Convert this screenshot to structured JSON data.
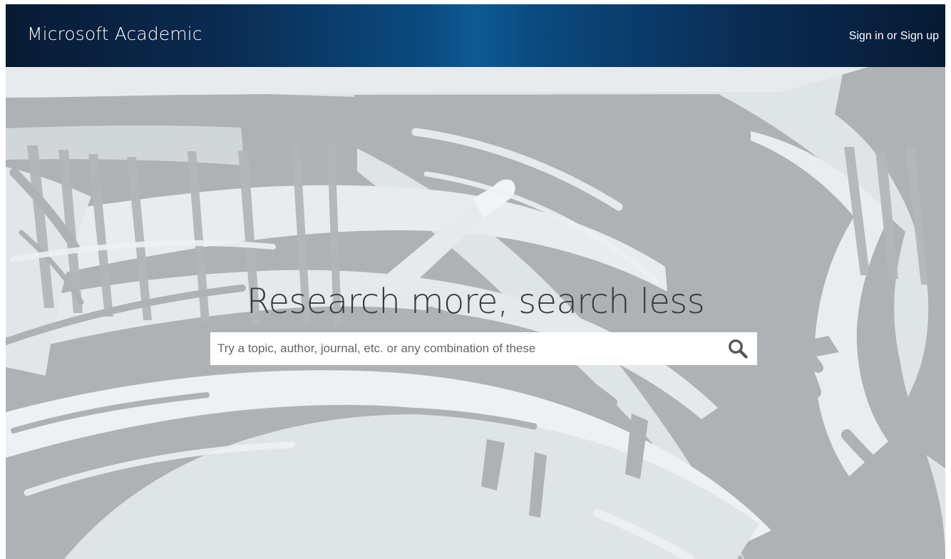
{
  "app": {
    "title": "Microsoft Academic"
  },
  "header": {
    "brand": "Microsoft Academic",
    "sign_in_label": "Sign in or Sign up"
  },
  "hero": {
    "headline": "Research more, search less"
  },
  "search": {
    "placeholder": "Try a topic, author, journal, etc. or any combination of these",
    "value": "",
    "icon": "search-icon"
  },
  "colors": {
    "header_dark": "#071a33",
    "header_accent": "#0d5b93",
    "hero_light": "#dfe4e7",
    "hero_shadow": "#aeb2b5",
    "headline_text": "#3a3a3a"
  }
}
